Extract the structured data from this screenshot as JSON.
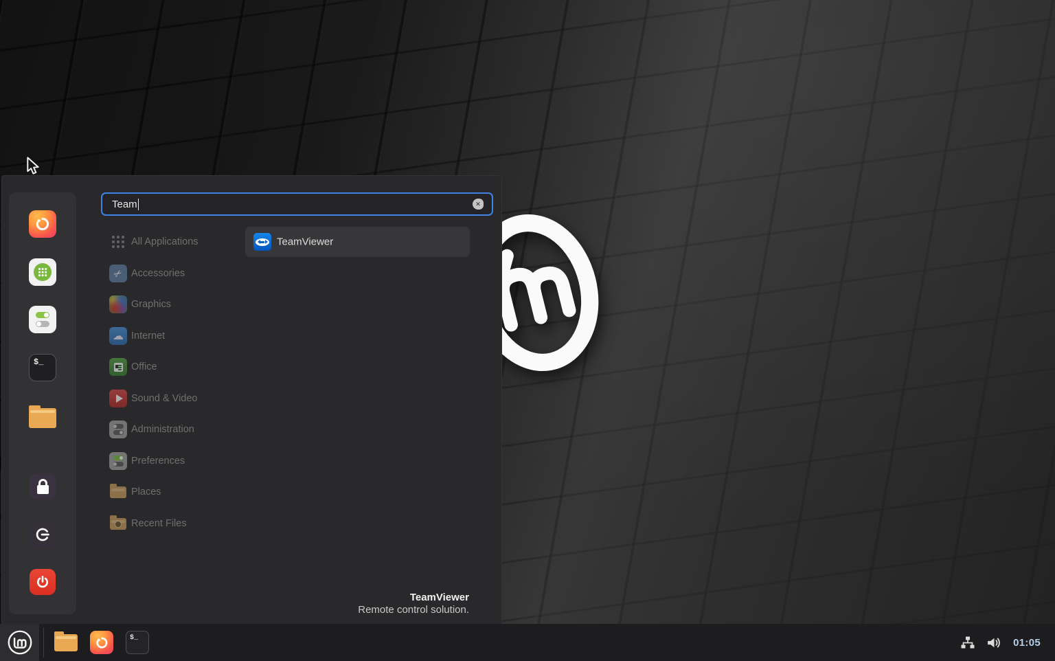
{
  "menu": {
    "search": {
      "value": "Team"
    },
    "categories": [
      {
        "label": "All Applications",
        "icon": "grid-icon"
      },
      {
        "label": "Accessories",
        "icon": "scissors-icon"
      },
      {
        "label": "Graphics",
        "icon": "palette-icon"
      },
      {
        "label": "Internet",
        "icon": "cloud-icon"
      },
      {
        "label": "Office",
        "icon": "document-icon"
      },
      {
        "label": "Sound & Video",
        "icon": "play-icon"
      },
      {
        "label": "Administration",
        "icon": "toggles-icon"
      },
      {
        "label": "Preferences",
        "icon": "toggles-green-icon"
      },
      {
        "label": "Places",
        "icon": "folder-icon"
      },
      {
        "label": "Recent Files",
        "icon": "folder-clock-icon"
      }
    ],
    "results": [
      {
        "label": "TeamViewer",
        "icon": "teamviewer-icon"
      }
    ],
    "selected_app": {
      "name": "TeamViewer",
      "description": "Remote control solution."
    },
    "favorites": [
      "firefox",
      "software-manager",
      "system-settings",
      "terminal",
      "files"
    ],
    "session_buttons": [
      "lock-screen",
      "logout",
      "shutdown"
    ]
  },
  "glyphs": {
    "terminal": "$_",
    "clear_search": "✕",
    "scissors": "✂",
    "cloud": "☁"
  },
  "taskbar": {
    "launchers": [
      "files",
      "firefox",
      "terminal"
    ],
    "tray": [
      "network",
      "volume"
    ],
    "clock": "01:05"
  },
  "colors": {
    "accent_blue": "#3f84e4",
    "teamviewer_blue": "#0b6fd4",
    "shutdown_red": "#e23b2c",
    "folder_orange": "#e9a853",
    "clock_text": "#b6cfe9",
    "menu_background": "#29292b",
    "taskbar_background": "#1d1d1f"
  }
}
